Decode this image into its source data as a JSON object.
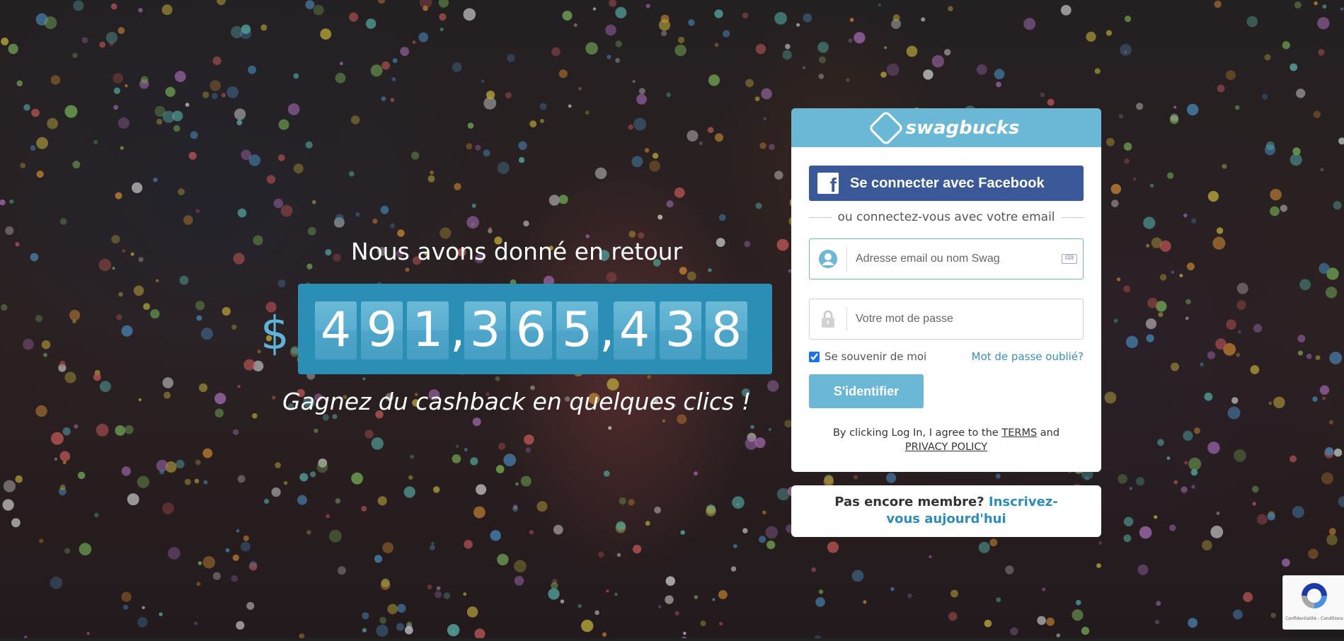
{
  "counter": {
    "title": "Nous avons donné en retour",
    "currency": "$",
    "digits": [
      "4",
      "9",
      "1",
      ",",
      "3",
      "6",
      "5",
      ",",
      "4",
      "3",
      "8"
    ],
    "tagline": "Gagnez du cashback en quelques clics !"
  },
  "login": {
    "brand": "swagbucks",
    "facebook_label": "Se connecter avec Facebook",
    "divider_text": "ou connectez-vous avec votre email",
    "email_placeholder": "Adresse email ou nom Swag",
    "password_placeholder": "Votre mot de passe",
    "remember_label": "Se souvenir de moi",
    "remember_checked": true,
    "forgot_label": "Mot de passe oublié?",
    "submit_label": "S'identifier",
    "terms_prefix": "By clicking Log In, I agree to the",
    "terms_link": "TERMS",
    "terms_and": "and",
    "privacy_link": "PRIVACY POLICY"
  },
  "signup": {
    "prompt": "Pas encore membre?",
    "link": "Inscrivez-vous aujourd'hui"
  },
  "recaptcha": {
    "text": "Confidentialité - Conditions"
  },
  "colors": {
    "accent": "#6ab8d6",
    "counter_bg": "#2b8fb5",
    "facebook": "#3b5998",
    "link": "#2c8dbb"
  }
}
